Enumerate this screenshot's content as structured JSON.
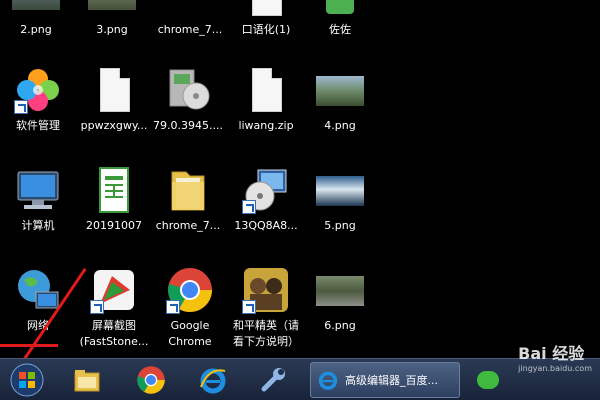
{
  "desktop": {
    "row0": [
      {
        "label": "2.png"
      },
      {
        "label": "3.png"
      },
      {
        "label": "chrome_7..."
      },
      {
        "label": "口语化(1)"
      },
      {
        "label": "佐佐"
      }
    ],
    "row1": [
      {
        "label": "软件管理",
        "icon": "software-manager-icon"
      },
      {
        "label": "ppwzxgwy...",
        "icon": "blank-file-icon"
      },
      {
        "label": "79.0.3945....",
        "icon": "installer-disc-icon"
      },
      {
        "label": "liwang.zip",
        "icon": "blank-file-icon"
      },
      {
        "label": "4.png",
        "icon": "image-thumbnail-icon"
      }
    ],
    "row2": [
      {
        "label": "计算机",
        "icon": "computer-icon"
      },
      {
        "label": "20191007",
        "icon": "spreadsheet-file-icon"
      },
      {
        "label": "chrome_7...",
        "icon": "folder-icon"
      },
      {
        "label": "13QQ8A8...",
        "icon": "setup-cd-icon"
      },
      {
        "label": "5.png",
        "icon": "image-thumbnail-icon"
      }
    ],
    "row3": [
      {
        "label": "网络",
        "icon": "network-globe-icon"
      },
      {
        "label": "屏幕截图\n(FastStone...",
        "icon": "faststone-capture-icon"
      },
      {
        "label": "Google\nChrome",
        "icon": "chrome-icon"
      },
      {
        "label": "和平精英（请\n看下方说明）",
        "icon": "game-icon"
      },
      {
        "label": "6.png",
        "icon": "image-thumbnail-icon"
      }
    ]
  },
  "taskbar": {
    "start": {
      "icon": "windows-start-icon"
    },
    "pinned": [
      {
        "icon": "explorer-folder-icon"
      },
      {
        "icon": "chrome-icon"
      },
      {
        "icon": "internet-explorer-icon"
      },
      {
        "icon": "wrench-tool-icon"
      }
    ],
    "active_window": {
      "label": "高级编辑器_百度...",
      "icon": "internet-explorer-icon"
    }
  },
  "watermark": {
    "text": "Bai 经验",
    "sub": "jingyan.baidu.com"
  },
  "colors": {
    "accent_red": "#e11b1b",
    "taskbar": "#1f2d47"
  }
}
